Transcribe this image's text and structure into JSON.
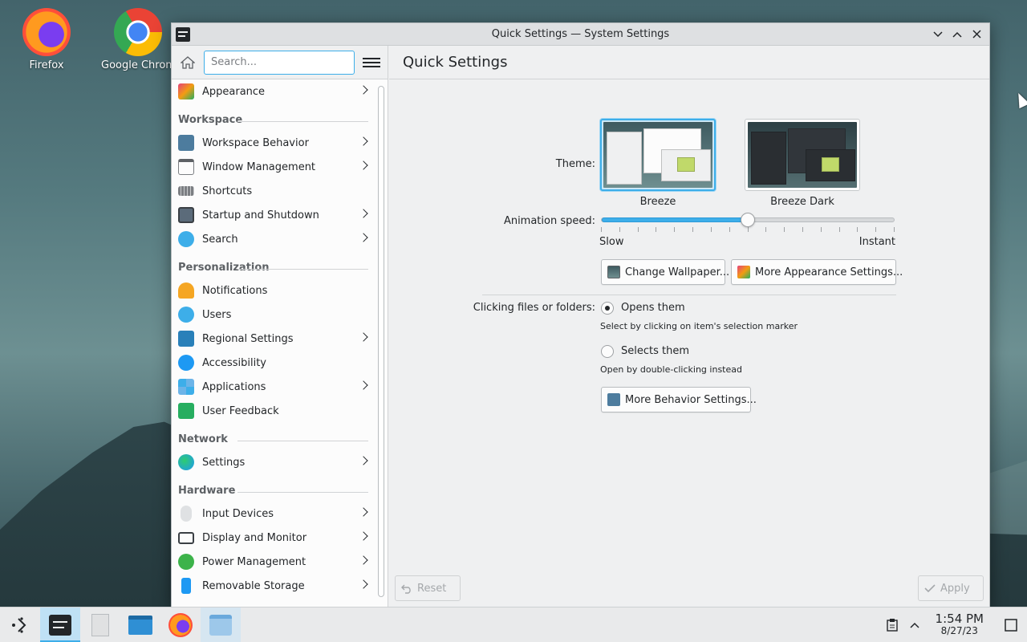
{
  "desktop": {
    "icons": [
      {
        "label": "Firefox"
      },
      {
        "label": "Google Chrom"
      }
    ]
  },
  "window": {
    "title": "Quick Settings — System Settings",
    "buttons": {
      "minimize": "⌄",
      "maximize": "⌃",
      "close": "✕"
    }
  },
  "sidebar": {
    "search_placeholder": "Search...",
    "appearance": {
      "label": "Appearance",
      "color": "#e5417c"
    },
    "categories": {
      "workspace": "Workspace",
      "personalization": "Personalization",
      "network": "Network",
      "hardware": "Hardware"
    },
    "workspace_items": [
      {
        "label": "Workspace Behavior",
        "icon": "workspace-behavior-icon",
        "color": "#4d7c9e"
      },
      {
        "label": "Window Management",
        "icon": "window-management-icon",
        "color": "#dfe1e3"
      },
      {
        "label": "Shortcuts",
        "icon": "keyboard-icon",
        "color": "#7b7e82"
      },
      {
        "label": "Startup and Shutdown",
        "icon": "startup-icon",
        "color": "#5b6b7a"
      },
      {
        "label": "Search",
        "icon": "search-icon",
        "color": "#3daee9"
      }
    ],
    "personalization_items": [
      {
        "label": "Notifications",
        "icon": "bell-icon",
        "color": "#f5a623"
      },
      {
        "label": "Users",
        "icon": "users-icon",
        "color": "#3daee9"
      },
      {
        "label": "Regional Settings",
        "icon": "regional-icon",
        "color": "#2980b9"
      },
      {
        "label": "Accessibility",
        "icon": "accessibility-icon",
        "color": "#1d99f3"
      },
      {
        "label": "Applications",
        "icon": "applications-icon",
        "color": "#6cb4e8"
      },
      {
        "label": "User Feedback",
        "icon": "feedback-icon",
        "color": "#27ae60"
      }
    ],
    "network_items": [
      {
        "label": "Settings",
        "icon": "globe-icon",
        "color": "#27ae60"
      }
    ],
    "hardware_items": [
      {
        "label": "Input Devices",
        "icon": "mouse-icon",
        "color": "#c8cacc"
      },
      {
        "label": "Display and Monitor",
        "icon": "monitor-icon",
        "color": "#3b4045"
      },
      {
        "label": "Power Management",
        "icon": "power-icon",
        "color": "#3cb34a"
      },
      {
        "label": "Removable Storage",
        "icon": "usb-icon",
        "color": "#1d99f3"
      }
    ]
  },
  "main": {
    "title": "Quick Settings",
    "theme_label": "Theme:",
    "themes": [
      {
        "name": "Breeze",
        "selected": true
      },
      {
        "name": "Breeze Dark",
        "selected": false
      }
    ],
    "animation_label": "Animation speed:",
    "animation_value": 0.5,
    "slider_min": "Slow",
    "slider_max": "Instant",
    "change_wallpaper": "Change Wallpaper...",
    "more_appearance": "More Appearance Settings...",
    "clicking_label": "Clicking files or folders:",
    "opens_them": "Opens them",
    "opens_hint": "Select by clicking on item's selection marker",
    "selects_them": "Selects them",
    "selects_hint": "Open by double-clicking instead",
    "more_behavior": "More Behavior Settings...",
    "reset": "Reset",
    "apply": "Apply",
    "accent": "#3daee9"
  },
  "taskbar": {
    "time": "1:54 PM",
    "date": "8/27/23"
  }
}
